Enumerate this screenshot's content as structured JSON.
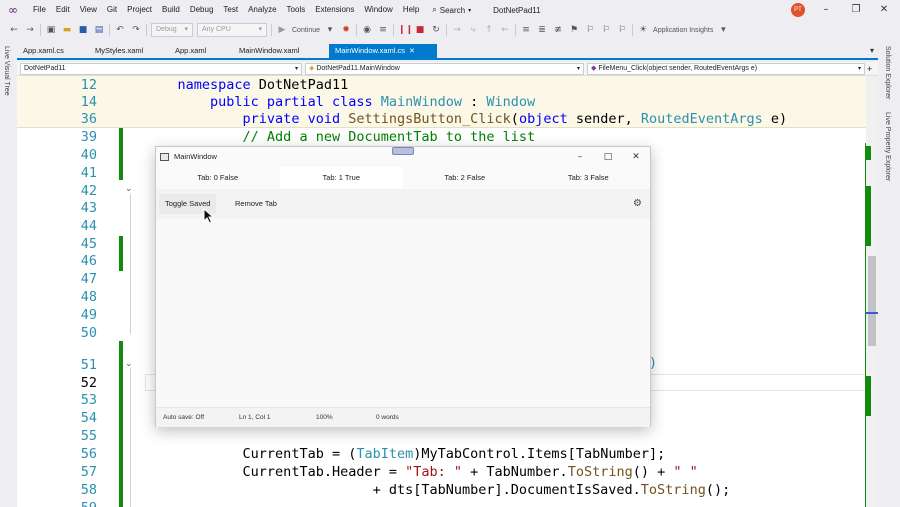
{
  "menu": {
    "items": [
      "File",
      "Edit",
      "View",
      "Git",
      "Project",
      "Build",
      "Debug",
      "Test",
      "Analyze",
      "Tools",
      "Extensions",
      "Window",
      "Help"
    ],
    "search_label": "Search",
    "solution_name": "DotNetPad11",
    "avatar_initials": "PT"
  },
  "toolbar": {
    "config_combo": "Debug",
    "platform_combo": "Any CPU",
    "continue_label": "Continue",
    "insights_label": "Application Insights"
  },
  "left_strip": {
    "live_visual_tree": "Live Visual Tree"
  },
  "right_strip": {
    "solution_explorer": "Solution Explorer",
    "live_property_explorer": "Live Property Explorer"
  },
  "doc_tabs": [
    {
      "label": "App.xaml.cs",
      "active": false
    },
    {
      "label": "MyStyles.xaml",
      "active": false
    },
    {
      "label": "App.xaml",
      "active": false
    },
    {
      "label": "MainWindow.xaml",
      "active": false
    },
    {
      "label": "MainWindow.xaml.cs",
      "active": true
    }
  ],
  "navbar": {
    "project": "DotNetPad11",
    "type": "DotNetPad11.MainWindow",
    "member": "FileMenu_Click(object sender, RoutedEventArgs e)"
  },
  "editor": {
    "sticky_lines": [
      {
        "ln": "12",
        "indent": "    ",
        "segs": [
          [
            "kw",
            "namespace"
          ],
          [
            "pl",
            " DotNetPad11"
          ]
        ]
      },
      {
        "ln": "14",
        "indent": "        ",
        "segs": [
          [
            "kw",
            "public partial class"
          ],
          [
            "pl",
            " "
          ],
          [
            "ty",
            "MainWindow"
          ],
          [
            "pl",
            " : "
          ],
          [
            "ty",
            "Window"
          ]
        ]
      },
      {
        "ln": "36",
        "indent": "            ",
        "segs": [
          [
            "kw",
            "private void"
          ],
          [
            "pl",
            " "
          ],
          [
            "mb",
            "SettingsButton_Click"
          ],
          [
            "pl",
            "("
          ],
          [
            "kw",
            "object"
          ],
          [
            "pl",
            " sender, "
          ],
          [
            "ty",
            "RoutedEventArgs"
          ],
          [
            "pl",
            " e)"
          ]
        ]
      }
    ],
    "lines": [
      {
        "ln": "39",
        "indent": "            ",
        "segs": [
          [
            "cm",
            "// Add a new DocumentTab to the list"
          ]
        ]
      },
      {
        "ln": "40",
        "indent": "",
        "segs": []
      },
      {
        "ln": "41",
        "indent": "",
        "segs": []
      },
      {
        "ln": "42",
        "indent": "",
        "segs": []
      },
      {
        "ln": "43",
        "indent": "",
        "segs": []
      },
      {
        "ln": "44",
        "indent": "",
        "segs": []
      },
      {
        "ln": "45",
        "indent": "",
        "segs": []
      },
      {
        "ln": "46",
        "indent": "",
        "segs": []
      },
      {
        "ln": "47",
        "indent": "",
        "segs": []
      },
      {
        "ln": "48",
        "indent": "",
        "segs": []
      },
      {
        "ln": "49",
        "indent": "",
        "segs": []
      },
      {
        "ln": "50",
        "indent": "",
        "segs": []
      },
      {
        "ln": "51",
        "indent": "",
        "segs": []
      },
      {
        "ln": "52",
        "indent": "",
        "segs": []
      },
      {
        "ln": "53",
        "indent": "",
        "segs": []
      },
      {
        "ln": "54",
        "indent": "",
        "segs": []
      },
      {
        "ln": "55",
        "indent": "",
        "segs": []
      },
      {
        "ln": "56",
        "indent": "            ",
        "segs": [
          [
            "pl",
            "CurrentTab = ("
          ],
          [
            "ty",
            "TabItem"
          ],
          [
            "pl",
            ")MyTabControl.Items["
          ],
          [
            "pl",
            "TabNumber"
          ],
          [
            "pl",
            "];"
          ]
        ]
      },
      {
        "ln": "57",
        "indent": "            ",
        "segs": [
          [
            "pl",
            "CurrentTab.Header = "
          ],
          [
            "st",
            "\"Tab: \""
          ],
          [
            "pl",
            " + TabNumber."
          ],
          [
            "mb",
            "ToString"
          ],
          [
            "pl",
            "() + "
          ],
          [
            "st",
            "\" \""
          ]
        ]
      },
      {
        "ln": "58",
        "indent": "                            ",
        "segs": [
          [
            "pl",
            "+ dts[TabNumber].DocumentIsSaved."
          ],
          [
            "mb",
            "ToString"
          ],
          [
            "pl",
            "();"
          ]
        ]
      },
      {
        "ln": "59",
        "indent": "",
        "segs": []
      }
    ],
    "current_line": "52",
    "peek_paren": ")"
  },
  "app_window": {
    "title": "MainWindow",
    "tabs": [
      {
        "label": "Tab: 0 False",
        "selected": false
      },
      {
        "label": "Tab: 1 True",
        "selected": true
      },
      {
        "label": "Tab: 2 False",
        "selected": false
      },
      {
        "label": "Tab: 3 False",
        "selected": false
      }
    ],
    "toggle_saved": "Toggle Saved",
    "remove_tab": "Remove Tab",
    "status": {
      "autosave": "Auto save: Off",
      "position": "Ln 1, Col 1",
      "zoom": "100%",
      "words": "0 words"
    }
  },
  "colors": {
    "accent": "#007acc",
    "change_bar": "#108b0c",
    "keyword": "#0000ff",
    "type": "#2b91af",
    "comment": "#008000",
    "string": "#a31515"
  }
}
